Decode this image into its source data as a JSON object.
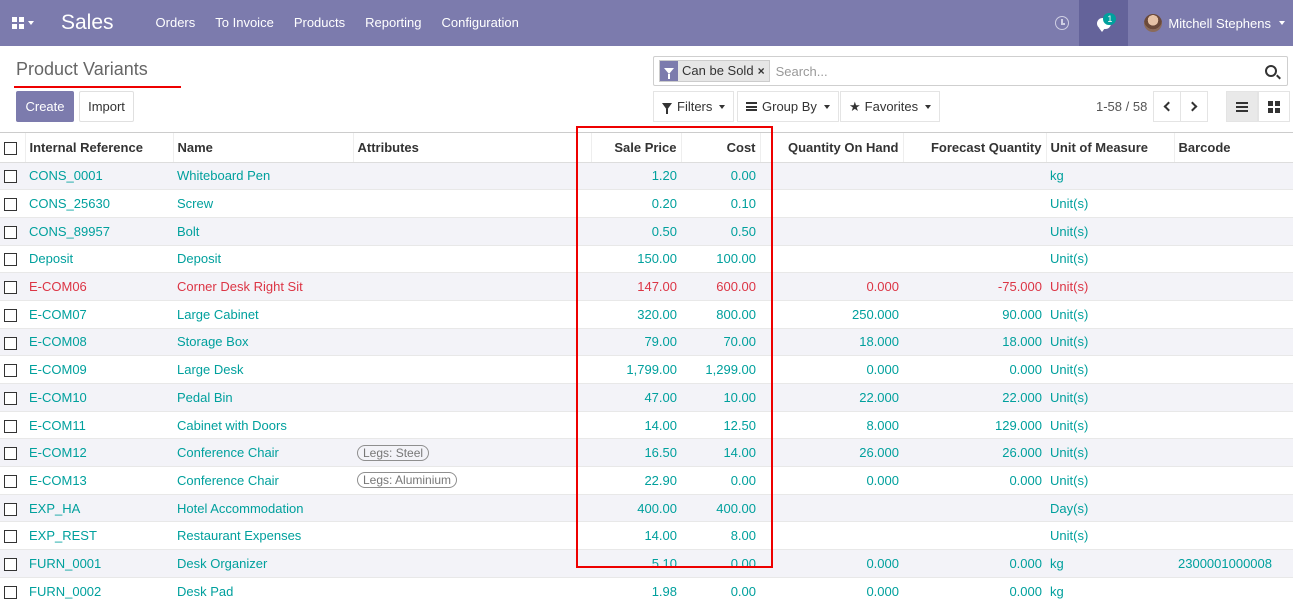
{
  "navbar": {
    "app_name": "Sales",
    "menu": [
      "Orders",
      "To Invoice",
      "Products",
      "Reporting",
      "Configuration"
    ],
    "chat_badge": "1",
    "user_name": "Mitchell Stephens",
    "color": "#7c7bad"
  },
  "control": {
    "title": "Product Variants",
    "create_label": "Create",
    "import_label": "Import",
    "facet_label": "Can be Sold",
    "facet_close": "×",
    "search_placeholder": "Search...",
    "filters_label": "Filters",
    "groupby_label": "Group By",
    "favorites_label": "Favorites",
    "pager": "1-58 / 58"
  },
  "table": {
    "headers": [
      "Internal Reference",
      "Name",
      "Attributes",
      "Sale Price",
      "Cost",
      "Quantity On Hand",
      "Forecast Quantity",
      "Unit of Measure",
      "Barcode"
    ],
    "rows": [
      {
        "ref": "CONS_0001",
        "name": "Whiteboard Pen",
        "attr": "",
        "price": "1.20",
        "cost": "0.00",
        "qoh": "",
        "forecast": "",
        "uom": "kg",
        "barcode": "",
        "danger": false
      },
      {
        "ref": "CONS_25630",
        "name": "Screw",
        "attr": "",
        "price": "0.20",
        "cost": "0.10",
        "qoh": "",
        "forecast": "",
        "uom": "Unit(s)",
        "barcode": "",
        "danger": false
      },
      {
        "ref": "CONS_89957",
        "name": "Bolt",
        "attr": "",
        "price": "0.50",
        "cost": "0.50",
        "qoh": "",
        "forecast": "",
        "uom": "Unit(s)",
        "barcode": "",
        "danger": false
      },
      {
        "ref": "Deposit",
        "name": "Deposit",
        "attr": "",
        "price": "150.00",
        "cost": "100.00",
        "qoh": "",
        "forecast": "",
        "uom": "Unit(s)",
        "barcode": "",
        "danger": false
      },
      {
        "ref": "E-COM06",
        "name": "Corner Desk Right Sit",
        "attr": "",
        "price": "147.00",
        "cost": "600.00",
        "qoh": "0.000",
        "forecast": "-75.000",
        "uom": "Unit(s)",
        "barcode": "",
        "danger": true
      },
      {
        "ref": "E-COM07",
        "name": "Large Cabinet",
        "attr": "",
        "price": "320.00",
        "cost": "800.00",
        "qoh": "250.000",
        "forecast": "90.000",
        "uom": "Unit(s)",
        "barcode": "",
        "danger": false
      },
      {
        "ref": "E-COM08",
        "name": "Storage Box",
        "attr": "",
        "price": "79.00",
        "cost": "70.00",
        "qoh": "18.000",
        "forecast": "18.000",
        "uom": "Unit(s)",
        "barcode": "",
        "danger": false
      },
      {
        "ref": "E-COM09",
        "name": "Large Desk",
        "attr": "",
        "price": "1,799.00",
        "cost": "1,299.00",
        "qoh": "0.000",
        "forecast": "0.000",
        "uom": "Unit(s)",
        "barcode": "",
        "danger": false
      },
      {
        "ref": "E-COM10",
        "name": "Pedal Bin",
        "attr": "",
        "price": "47.00",
        "cost": "10.00",
        "qoh": "22.000",
        "forecast": "22.000",
        "uom": "Unit(s)",
        "barcode": "",
        "danger": false
      },
      {
        "ref": "E-COM11",
        "name": "Cabinet with Doors",
        "attr": "",
        "price": "14.00",
        "cost": "12.50",
        "qoh": "8.000",
        "forecast": "129.000",
        "uom": "Unit(s)",
        "barcode": "",
        "danger": false
      },
      {
        "ref": "E-COM12",
        "name": "Conference Chair",
        "attr": "Legs: Steel",
        "price": "16.50",
        "cost": "14.00",
        "qoh": "26.000",
        "forecast": "26.000",
        "uom": "Unit(s)",
        "barcode": "",
        "danger": false
      },
      {
        "ref": "E-COM13",
        "name": "Conference Chair",
        "attr": "Legs: Aluminium",
        "price": "22.90",
        "cost": "0.00",
        "qoh": "0.000",
        "forecast": "0.000",
        "uom": "Unit(s)",
        "barcode": "",
        "danger": false
      },
      {
        "ref": "EXP_HA",
        "name": "Hotel Accommodation",
        "attr": "",
        "price": "400.00",
        "cost": "400.00",
        "qoh": "",
        "forecast": "",
        "uom": "Day(s)",
        "barcode": "",
        "danger": false
      },
      {
        "ref": "EXP_REST",
        "name": "Restaurant Expenses",
        "attr": "",
        "price": "14.00",
        "cost": "8.00",
        "qoh": "",
        "forecast": "",
        "uom": "Unit(s)",
        "barcode": "",
        "danger": false
      },
      {
        "ref": "FURN_0001",
        "name": "Desk Organizer",
        "attr": "",
        "price": "5.10",
        "cost": "0.00",
        "qoh": "0.000",
        "forecast": "0.000",
        "uom": "kg",
        "barcode": "2300001000008",
        "danger": false
      },
      {
        "ref": "FURN_0002",
        "name": "Desk Pad",
        "attr": "",
        "price": "1.98",
        "cost": "0.00",
        "qoh": "0.000",
        "forecast": "0.000",
        "uom": "kg",
        "barcode": "",
        "danger": false
      }
    ]
  }
}
